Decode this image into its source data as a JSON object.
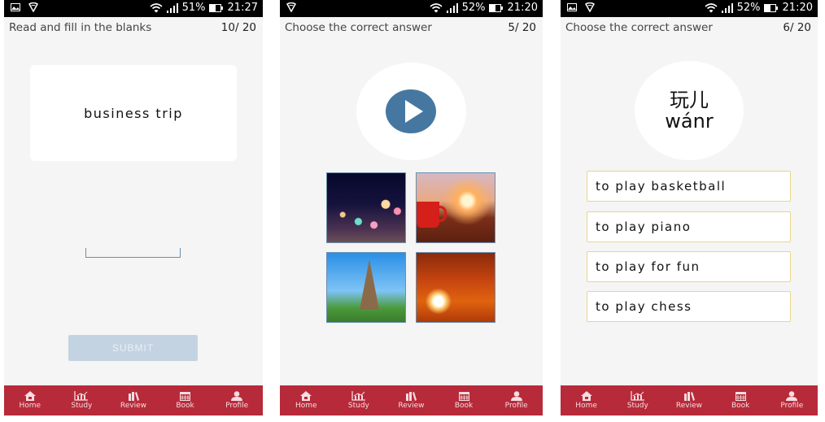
{
  "screens": [
    {
      "status": {
        "battery": "51%",
        "time": "21:27",
        "left_icons": [
          "image-icon",
          "vpn-shield-icon"
        ]
      },
      "header": {
        "title": "Read and fill in the blanks",
        "progress": "10/ 20"
      },
      "prompt": "business trip",
      "answer_input": {
        "value": "",
        "placeholder": ""
      },
      "submit_label": "SUBMIT"
    },
    {
      "status": {
        "battery": "52%",
        "time": "21:20",
        "left_icons": [
          "vpn-shield-icon"
        ]
      },
      "header": {
        "title": "Choose the correct answer",
        "progress": "5/ 20"
      },
      "audio_button": "play-icon",
      "image_options": [
        "city-lights-bokeh",
        "red-cup-sunset",
        "eiffel-tower",
        "orange-sunset"
      ]
    },
    {
      "status": {
        "battery": "52%",
        "time": "21:20",
        "left_icons": [
          "image-icon",
          "vpn-shield-icon"
        ]
      },
      "header": {
        "title": "Choose the correct answer",
        "progress": "6/ 20"
      },
      "word": {
        "hanzi": "玩儿",
        "pinyin": "wánr"
      },
      "options": [
        "to play basketball",
        "to play piano",
        "to play for fun",
        "to play chess"
      ]
    }
  ],
  "nav": [
    {
      "label": "Home",
      "icon": "home-icon"
    },
    {
      "label": "Study",
      "icon": "chart-icon"
    },
    {
      "label": "Review",
      "icon": "books-icon"
    },
    {
      "label": "Book",
      "icon": "calendar-icon"
    },
    {
      "label": "Profile",
      "icon": "profile-icon"
    }
  ],
  "colors": {
    "nav_bg": "#b72a3a",
    "accent_blue": "#4677a0",
    "option_border": "#ead58a",
    "submit_disabled": "#c3d3e1"
  }
}
